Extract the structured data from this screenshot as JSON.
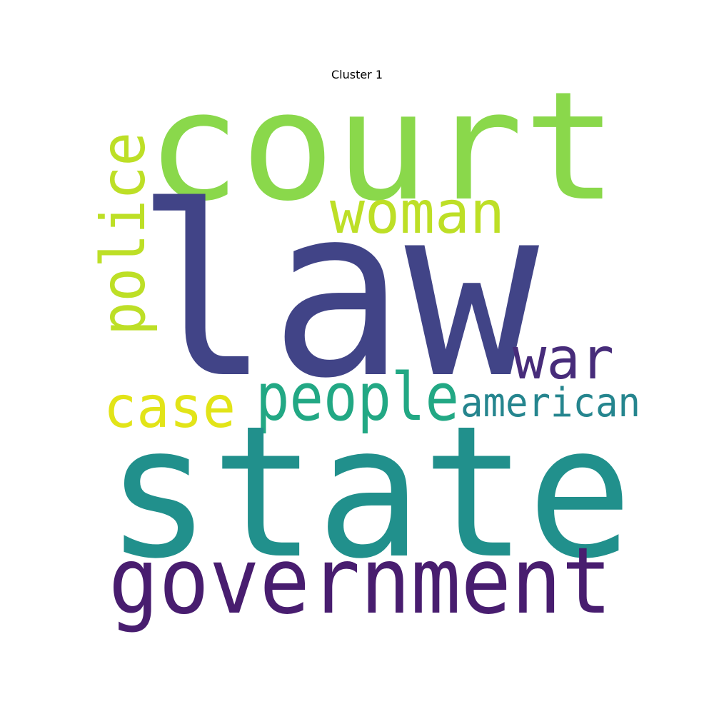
{
  "title": "Cluster 1",
  "words": {
    "law": {
      "text": "law",
      "color": "#414487"
    },
    "state": {
      "text": "state",
      "color": "#21908c"
    },
    "court": {
      "text": "court",
      "color": "#8ad84b"
    },
    "government": {
      "text": "government",
      "color": "#481d6f"
    },
    "people": {
      "text": "people",
      "color": "#22a884"
    },
    "woman": {
      "text": "woman",
      "color": "#bddf26"
    },
    "police": {
      "text": "police",
      "color": "#bddf26"
    },
    "war": {
      "text": "war",
      "color": "#472c7a"
    },
    "case": {
      "text": "case",
      "color": "#e2e418"
    },
    "american": {
      "text": "american",
      "color": "#25858e"
    }
  }
}
